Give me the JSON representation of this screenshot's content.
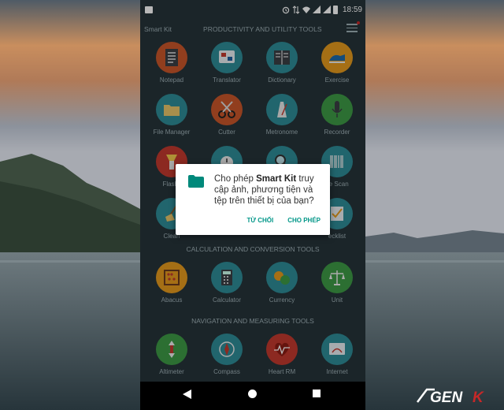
{
  "status_bar": {
    "time": "18:59"
  },
  "app_bar": {
    "app_name": "Smart Kit",
    "section": "PRODUCTIVITY AND UTILITY TOOLS"
  },
  "productivity_tools": [
    {
      "label": "Notepad",
      "icon": "notepad-icon",
      "color": "#c9572a"
    },
    {
      "label": "Translator",
      "icon": "translator-icon",
      "color": "#2e8c97"
    },
    {
      "label": "Dictionary",
      "icon": "dictionary-icon",
      "color": "#2e8c97"
    },
    {
      "label": "Exercise",
      "icon": "exercise-icon",
      "color": "#e59a1e"
    },
    {
      "label": "File Manager",
      "icon": "folder-icon",
      "color": "#2e8c97"
    },
    {
      "label": "Cutter",
      "icon": "scissors-icon",
      "color": "#c9572a"
    },
    {
      "label": "Metronome",
      "icon": "metronome-icon",
      "color": "#2e8c97"
    },
    {
      "label": "Recorder",
      "icon": "microphone-icon",
      "color": "#3e9a46"
    },
    {
      "label": "Flashli",
      "icon": "flashlight-icon",
      "color": "#c23a2e"
    },
    {
      "label": "",
      "icon": "stopwatch-icon",
      "color": "#2e8c97"
    },
    {
      "label": "",
      "icon": "magnifier-icon",
      "color": "#2e8c97"
    },
    {
      "label": "de Scan",
      "icon": "barcode-icon",
      "color": "#2e8c97"
    },
    {
      "label": "Clean",
      "icon": "broom-icon",
      "color": "#2e8c97"
    },
    {
      "label": "",
      "icon": "",
      "color": ""
    },
    {
      "label": "",
      "icon": "",
      "color": ""
    },
    {
      "label": "ecklist",
      "icon": "checklist-icon",
      "color": "#2e8c97"
    }
  ],
  "calculation_section": "CALCULATION AND CONVERSION TOOLS",
  "calculation_tools": [
    {
      "label": "Abacus",
      "icon": "abacus-icon",
      "color": "#e59a1e"
    },
    {
      "label": "Calculator",
      "icon": "calculator-icon",
      "color": "#2e8c97"
    },
    {
      "label": "Currency",
      "icon": "currency-icon",
      "color": "#2e8c97"
    },
    {
      "label": "Unit",
      "icon": "scale-icon",
      "color": "#3e9a46"
    }
  ],
  "navigation_section": "NAVIGATION AND MEASURING TOOLS",
  "navigation_tools": [
    {
      "label": "Altimeter",
      "icon": "altimeter-icon",
      "color": "#3e9a46"
    },
    {
      "label": "Compass",
      "icon": "compass-icon",
      "color": "#2e8c97"
    },
    {
      "label": "Heart RM",
      "icon": "heart-rate-icon",
      "color": "#c23a2e"
    },
    {
      "label": "Internet",
      "icon": "internet-speed-icon",
      "color": "#2e8c97"
    }
  ],
  "dialog": {
    "line_prefix": "Cho phép ",
    "app_name": "Smart Kit",
    "line_suffix": " truy cập ảnh, phương tiện và tệp trên thiết bị của bạn?",
    "deny_label": "TỪ CHỐI",
    "allow_label": "CHO PHÉP",
    "accent_color": "#009688"
  },
  "watermark": "GENK"
}
